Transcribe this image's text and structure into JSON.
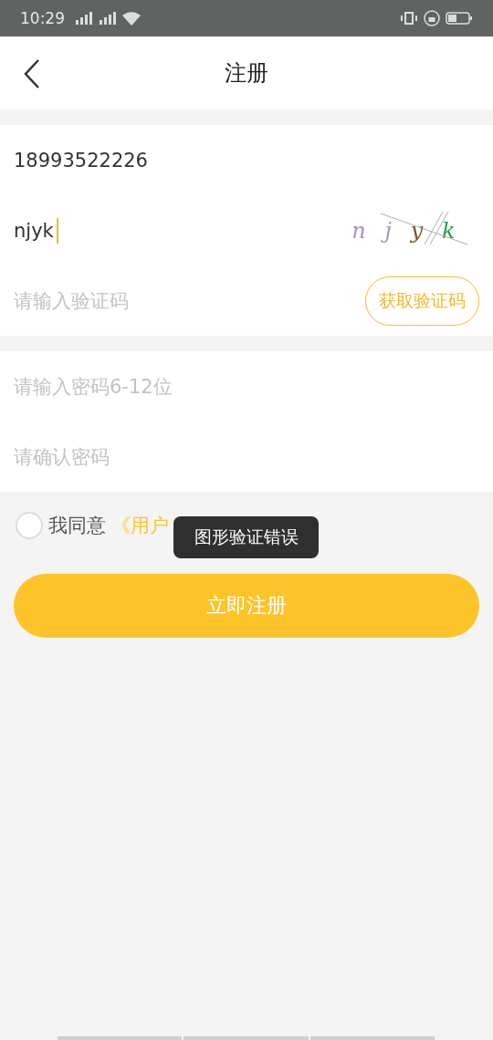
{
  "status_bar": {
    "time": "10:29"
  },
  "header": {
    "title": "注册"
  },
  "form": {
    "phone": {
      "value": "18993522226"
    },
    "captcha": {
      "value": "njyk",
      "focused": true,
      "chars": [
        {
          "text": "n",
          "color": "#a493c4"
        },
        {
          "text": "j",
          "color": "#a493c4"
        },
        {
          "text": "y",
          "color": "#7a5a2c"
        },
        {
          "text": "k",
          "color": "#2e9a4a"
        }
      ]
    },
    "sms_code": {
      "placeholder": "请输入验证码",
      "button": "获取验证码"
    },
    "password": {
      "placeholder": "请输入密码6-12位"
    },
    "confirm_password": {
      "placeholder": "请确认密码"
    }
  },
  "agreement": {
    "checked": false,
    "label": "我同意",
    "link": "《用户"
  },
  "toast": "图形验证错误",
  "submit_button": "立即注册"
}
